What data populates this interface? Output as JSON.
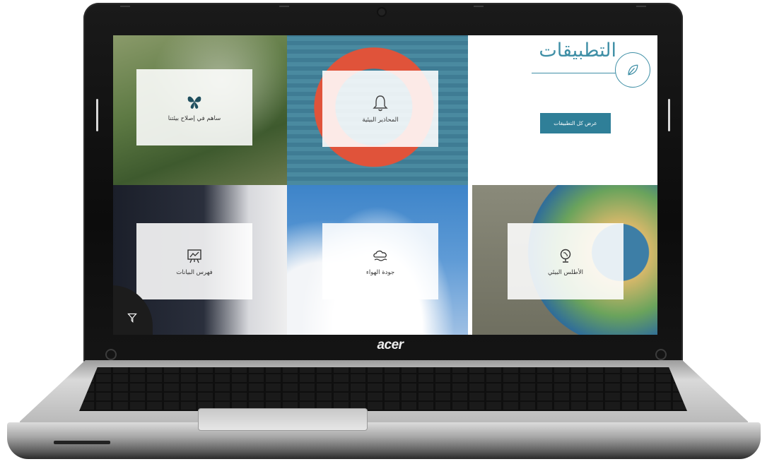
{
  "brand": "acer",
  "apps_panel": {
    "title": "التطبيقات",
    "button_label": "عرض كل التطبيقات"
  },
  "tiles": {
    "contribute": "ساهم في إصلاح بيئتنا",
    "alerts": "المحاذير البيئية",
    "data_catalog": "فهرس البيانات",
    "air_quality": "جودة الهواء",
    "atlas": "الأطلس البيئي"
  },
  "icons": {
    "contribute": "butterfly-icon",
    "alerts": "bell-icon",
    "data_catalog": "data-board-icon",
    "air_quality": "cloud-icon",
    "atlas": "globe-icon",
    "apps": "leaf-icon",
    "filter": "filter-icon"
  },
  "colors": {
    "accent": "#3f8fa6",
    "button": "#2f7f98"
  }
}
